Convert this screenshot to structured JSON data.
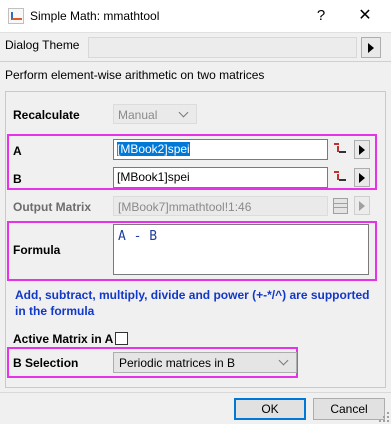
{
  "window": {
    "title": "Simple Math: mmathtool",
    "help_glyph": "?",
    "close_glyph": "✕"
  },
  "theme": {
    "label": "Dialog Theme",
    "value": ""
  },
  "description": "Perform element-wise arithmetic on two matrices",
  "recalculate": {
    "label": "Recalculate",
    "value": "Manual",
    "enabled": false
  },
  "matrix_a": {
    "label": "A",
    "value": "[MBook2]spei",
    "selected": true
  },
  "matrix_b": {
    "label": "B",
    "value": "[MBook1]spei"
  },
  "output_matrix": {
    "label": "Output Matrix",
    "value": "[MBook7]mmathtool!1:46",
    "enabled": false
  },
  "formula": {
    "label": "Formula",
    "value": "A - B"
  },
  "note": "Add, subtract, multiply, divide and power (+-*/^) are supported in the formula",
  "active_matrix": {
    "label": "Active Matrix in A",
    "checked": false
  },
  "b_selection": {
    "label": "B Selection",
    "value": "Periodic matrices in B"
  },
  "buttons": {
    "ok": "OK",
    "cancel": "Cancel"
  },
  "colors": {
    "highlight_border": "#e832e8",
    "note_text": "#1238c7",
    "selection": "#0078d7",
    "formula_text": "#1f3fa0"
  },
  "icons": [
    "app-icon",
    "help-icon",
    "close-icon",
    "expand-arrow-icon",
    "pick-range-icon",
    "matrix-grid-icon",
    "chevron-down-icon",
    "resize-grip-icon"
  ]
}
